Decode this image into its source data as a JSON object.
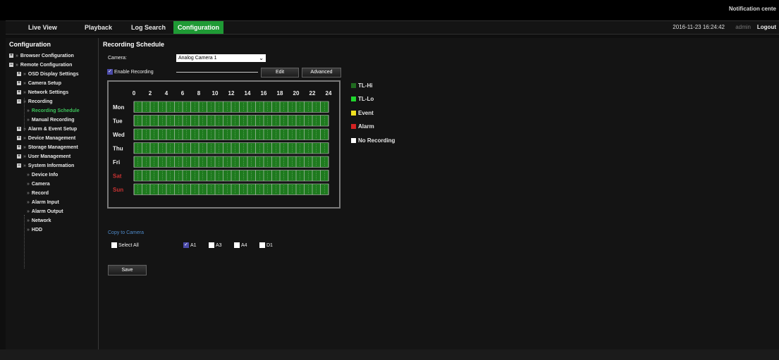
{
  "header": {
    "notification": "Notification cente",
    "nav": [
      "Live View",
      "Playback",
      "Log Search",
      "Configuration"
    ],
    "active_nav": "Configuration",
    "datetime": "2016-11-23 16:24:42",
    "user": "admin",
    "logout": "Logout"
  },
  "sidebar": {
    "title": "Configuration",
    "items": [
      {
        "label": "Browser Configuration",
        "level": 0
      },
      {
        "label": "Remote Configuration",
        "level": 0
      },
      {
        "label": "OSD Display Settings",
        "level": 1
      },
      {
        "label": "Camera Setup",
        "level": 1
      },
      {
        "label": "Network Settings",
        "level": 1
      },
      {
        "label": "Recording",
        "level": 1
      },
      {
        "label": "Recording Schedule",
        "level": 2,
        "active": true
      },
      {
        "label": "Manual Recording",
        "level": 2
      },
      {
        "label": "Alarm & Event Setup",
        "level": 1
      },
      {
        "label": "Device Management",
        "level": 1
      },
      {
        "label": "Storage Management",
        "level": 1
      },
      {
        "label": "User Management",
        "level": 1
      },
      {
        "label": "System Information",
        "level": 1
      },
      {
        "label": "Device Info",
        "level": 2
      },
      {
        "label": "Camera",
        "level": 2
      },
      {
        "label": "Record",
        "level": 2
      },
      {
        "label": "Alarm Input",
        "level": 2
      },
      {
        "label": "Alarm Output",
        "level": 2
      },
      {
        "label": "Network",
        "level": 2
      },
      {
        "label": "HDD",
        "level": 2
      }
    ]
  },
  "main": {
    "title": "Recording Schedule",
    "camera_label": "Camera:",
    "camera_value": "Analog Camera 1",
    "enable_recording_label": "Enable Recording",
    "enable_recording_checked": true,
    "edit_button": "Edit",
    "advanced_button": "Advanced",
    "hours": [
      "0",
      "2",
      "4",
      "6",
      "8",
      "10",
      "12",
      "14",
      "16",
      "18",
      "20",
      "22",
      "24"
    ],
    "days": [
      {
        "label": "Mon",
        "weekend": false
      },
      {
        "label": "Tue",
        "weekend": false
      },
      {
        "label": "Wed",
        "weekend": false
      },
      {
        "label": "Thu",
        "weekend": false
      },
      {
        "label": "Fri",
        "weekend": false
      },
      {
        "label": "Sat",
        "weekend": true
      },
      {
        "label": "Sun",
        "weekend": true
      }
    ],
    "schedule_mode": "TL-Lo",
    "legend": [
      {
        "label": "TL-Hi",
        "color": "#1f6b1f"
      },
      {
        "label": "TL-Lo",
        "color": "#1fd62d"
      },
      {
        "label": "Event",
        "color": "#f0e020"
      },
      {
        "label": "Alarm",
        "color": "#d42222"
      },
      {
        "label": "No Recording",
        "color": "#ffffff"
      }
    ],
    "copy_to_camera_label": "Copy to Camera",
    "select_all_label": "Select All",
    "cameras": [
      {
        "label": "A1",
        "checked": true
      },
      {
        "label": "A3",
        "checked": false
      },
      {
        "label": "A4",
        "checked": false
      },
      {
        "label": "D1",
        "checked": false
      }
    ],
    "save_button": "Save"
  },
  "colors": {
    "accent": "#1f9a35",
    "grid_fill": "#1e7a1e",
    "weekend_text": "#c83232",
    "link": "#4e89c8"
  }
}
